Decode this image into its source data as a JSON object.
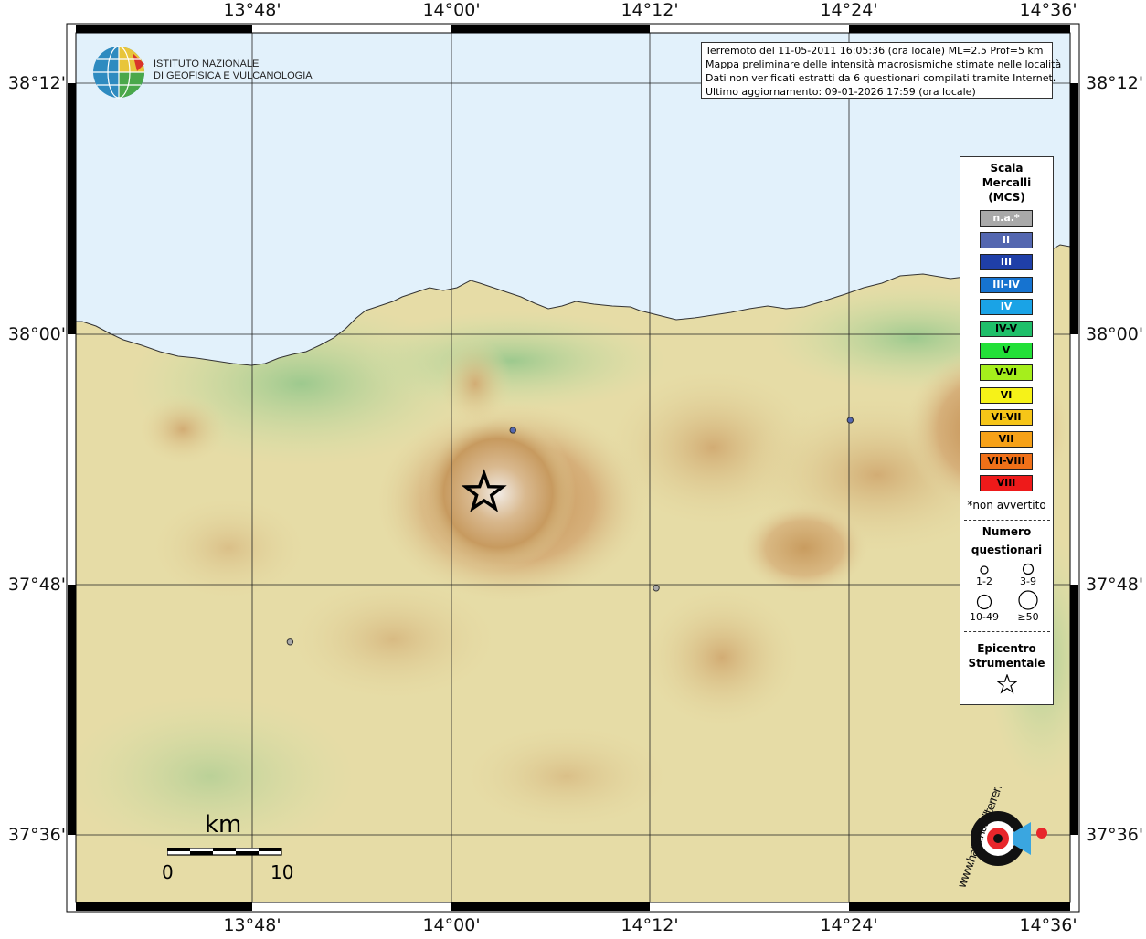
{
  "map": {
    "lon_ticks": [
      "13°48'",
      "14°00'",
      "14°12'",
      "14°24'",
      "14°36'"
    ],
    "lat_ticks": [
      "38°12'",
      "38°00'",
      "37°48'",
      "37°36'"
    ]
  },
  "header": {
    "line1": "Terremoto del 11-05-2011 16:05:36 (ora locale) ML=2.5 Prof=5 km",
    "line2": "Mappa preliminare delle intensità macrosismiche stimate nelle località",
    "line3": "Dati non verificati estratti da 6 questionari compilati tramite Internet.",
    "line4": "Ultimo aggiornamento: 09-01-2026 17:59 (ora locale)"
  },
  "ingv": {
    "line1": "ISTITUTO NAZIONALE",
    "line2": "DI GEOFISICA E VULCANOLOGIA"
  },
  "legend": {
    "title_line1": "Scala",
    "title_line2": "Mercalli",
    "title_line3": "(MCS)",
    "items": [
      {
        "label": "n.a.*",
        "color": "#a9a9a9",
        "text_color": "#ffffff"
      },
      {
        "label": "II",
        "color": "#5467b0",
        "text_color": "#ffffff"
      },
      {
        "label": "III",
        "color": "#1f3fa8",
        "text_color": "#ffffff"
      },
      {
        "label": "III-IV",
        "color": "#1673d0",
        "text_color": "#ffffff"
      },
      {
        "label": "IV",
        "color": "#1aa3e6",
        "text_color": "#ffffff"
      },
      {
        "label": "IV-V",
        "color": "#1fbf6a",
        "text_color": "#000000"
      },
      {
        "label": "V",
        "color": "#22e038",
        "text_color": "#000000"
      },
      {
        "label": "V-VI",
        "color": "#a5ee1c",
        "text_color": "#000000"
      },
      {
        "label": "VI",
        "color": "#f6f218",
        "text_color": "#000000"
      },
      {
        "label": "VI-VII",
        "color": "#f6c518",
        "text_color": "#000000"
      },
      {
        "label": "VII",
        "color": "#f6a118",
        "text_color": "#000000"
      },
      {
        "label": "VII-VIII",
        "color": "#f07018",
        "text_color": "#000000"
      },
      {
        "label": "VIII",
        "color": "#ee1a1a",
        "text_color": "#000000"
      }
    ],
    "note": "*non avvertito",
    "count_title_line1": "Numero",
    "count_title_line2": "questionari",
    "count_labels": [
      "1-2",
      "3-9",
      "10-49",
      "≥50"
    ],
    "epi_title_line1": "Epicentro",
    "epi_title_line2": "Strumentale"
  },
  "scale": {
    "unit": "km",
    "min": "0",
    "max": "10"
  },
  "observations": [
    {
      "lon": 14.062,
      "lat": 37.923,
      "intensity": "II"
    },
    {
      "lon": 14.401,
      "lat": 37.931,
      "intensity": "II"
    },
    {
      "lon": 14.206,
      "lat": 37.797,
      "intensity": "n.a.*"
    },
    {
      "lon": 13.838,
      "lat": 37.754,
      "intensity": "n.a.*"
    }
  ],
  "epicenter": {
    "lon": 14.033,
    "lat": 37.873
  },
  "colors": {
    "sea": "#e2f1fb",
    "frame": "#000000"
  },
  "hst_logo": {
    "text": "www.haisentitoilterremoto.it"
  }
}
